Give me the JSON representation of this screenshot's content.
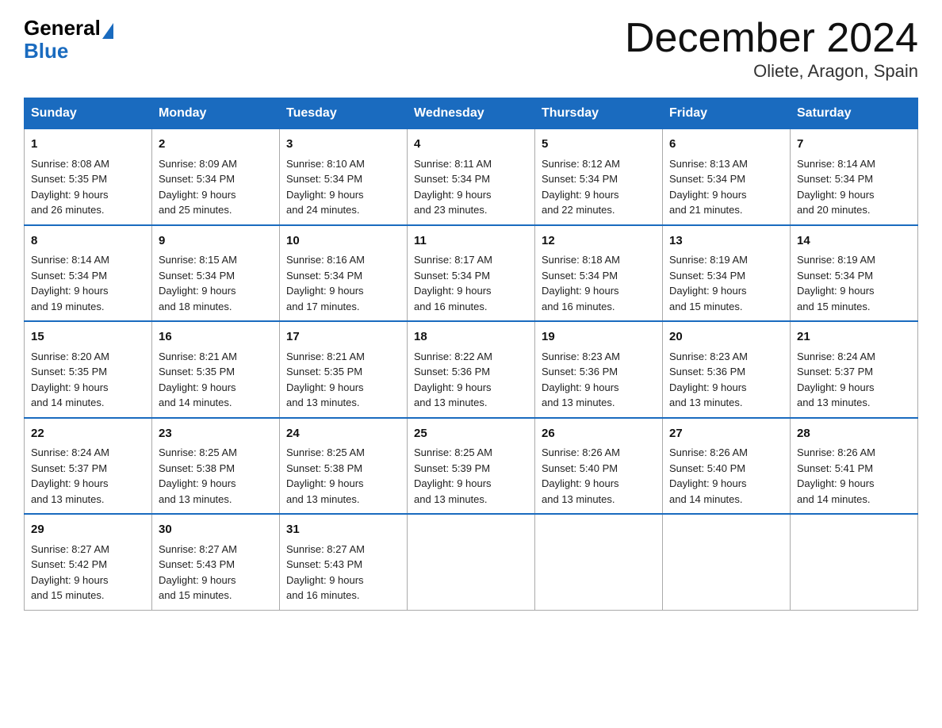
{
  "logo": {
    "general": "General",
    "blue": "Blue"
  },
  "title": "December 2024",
  "subtitle": "Oliete, Aragon, Spain",
  "days_of_week": [
    "Sunday",
    "Monday",
    "Tuesday",
    "Wednesday",
    "Thursday",
    "Friday",
    "Saturday"
  ],
  "weeks": [
    [
      {
        "day": "1",
        "sunrise": "Sunrise: 8:08 AM",
        "sunset": "Sunset: 5:35 PM",
        "daylight": "Daylight: 9 hours",
        "daylight2": "and 26 minutes."
      },
      {
        "day": "2",
        "sunrise": "Sunrise: 8:09 AM",
        "sunset": "Sunset: 5:34 PM",
        "daylight": "Daylight: 9 hours",
        "daylight2": "and 25 minutes."
      },
      {
        "day": "3",
        "sunrise": "Sunrise: 8:10 AM",
        "sunset": "Sunset: 5:34 PM",
        "daylight": "Daylight: 9 hours",
        "daylight2": "and 24 minutes."
      },
      {
        "day": "4",
        "sunrise": "Sunrise: 8:11 AM",
        "sunset": "Sunset: 5:34 PM",
        "daylight": "Daylight: 9 hours",
        "daylight2": "and 23 minutes."
      },
      {
        "day": "5",
        "sunrise": "Sunrise: 8:12 AM",
        "sunset": "Sunset: 5:34 PM",
        "daylight": "Daylight: 9 hours",
        "daylight2": "and 22 minutes."
      },
      {
        "day": "6",
        "sunrise": "Sunrise: 8:13 AM",
        "sunset": "Sunset: 5:34 PM",
        "daylight": "Daylight: 9 hours",
        "daylight2": "and 21 minutes."
      },
      {
        "day": "7",
        "sunrise": "Sunrise: 8:14 AM",
        "sunset": "Sunset: 5:34 PM",
        "daylight": "Daylight: 9 hours",
        "daylight2": "and 20 minutes."
      }
    ],
    [
      {
        "day": "8",
        "sunrise": "Sunrise: 8:14 AM",
        "sunset": "Sunset: 5:34 PM",
        "daylight": "Daylight: 9 hours",
        "daylight2": "and 19 minutes."
      },
      {
        "day": "9",
        "sunrise": "Sunrise: 8:15 AM",
        "sunset": "Sunset: 5:34 PM",
        "daylight": "Daylight: 9 hours",
        "daylight2": "and 18 minutes."
      },
      {
        "day": "10",
        "sunrise": "Sunrise: 8:16 AM",
        "sunset": "Sunset: 5:34 PM",
        "daylight": "Daylight: 9 hours",
        "daylight2": "and 17 minutes."
      },
      {
        "day": "11",
        "sunrise": "Sunrise: 8:17 AM",
        "sunset": "Sunset: 5:34 PM",
        "daylight": "Daylight: 9 hours",
        "daylight2": "and 16 minutes."
      },
      {
        "day": "12",
        "sunrise": "Sunrise: 8:18 AM",
        "sunset": "Sunset: 5:34 PM",
        "daylight": "Daylight: 9 hours",
        "daylight2": "and 16 minutes."
      },
      {
        "day": "13",
        "sunrise": "Sunrise: 8:19 AM",
        "sunset": "Sunset: 5:34 PM",
        "daylight": "Daylight: 9 hours",
        "daylight2": "and 15 minutes."
      },
      {
        "day": "14",
        "sunrise": "Sunrise: 8:19 AM",
        "sunset": "Sunset: 5:34 PM",
        "daylight": "Daylight: 9 hours",
        "daylight2": "and 15 minutes."
      }
    ],
    [
      {
        "day": "15",
        "sunrise": "Sunrise: 8:20 AM",
        "sunset": "Sunset: 5:35 PM",
        "daylight": "Daylight: 9 hours",
        "daylight2": "and 14 minutes."
      },
      {
        "day": "16",
        "sunrise": "Sunrise: 8:21 AM",
        "sunset": "Sunset: 5:35 PM",
        "daylight": "Daylight: 9 hours",
        "daylight2": "and 14 minutes."
      },
      {
        "day": "17",
        "sunrise": "Sunrise: 8:21 AM",
        "sunset": "Sunset: 5:35 PM",
        "daylight": "Daylight: 9 hours",
        "daylight2": "and 13 minutes."
      },
      {
        "day": "18",
        "sunrise": "Sunrise: 8:22 AM",
        "sunset": "Sunset: 5:36 PM",
        "daylight": "Daylight: 9 hours",
        "daylight2": "and 13 minutes."
      },
      {
        "day": "19",
        "sunrise": "Sunrise: 8:23 AM",
        "sunset": "Sunset: 5:36 PM",
        "daylight": "Daylight: 9 hours",
        "daylight2": "and 13 minutes."
      },
      {
        "day": "20",
        "sunrise": "Sunrise: 8:23 AM",
        "sunset": "Sunset: 5:36 PM",
        "daylight": "Daylight: 9 hours",
        "daylight2": "and 13 minutes."
      },
      {
        "day": "21",
        "sunrise": "Sunrise: 8:24 AM",
        "sunset": "Sunset: 5:37 PM",
        "daylight": "Daylight: 9 hours",
        "daylight2": "and 13 minutes."
      }
    ],
    [
      {
        "day": "22",
        "sunrise": "Sunrise: 8:24 AM",
        "sunset": "Sunset: 5:37 PM",
        "daylight": "Daylight: 9 hours",
        "daylight2": "and 13 minutes."
      },
      {
        "day": "23",
        "sunrise": "Sunrise: 8:25 AM",
        "sunset": "Sunset: 5:38 PM",
        "daylight": "Daylight: 9 hours",
        "daylight2": "and 13 minutes."
      },
      {
        "day": "24",
        "sunrise": "Sunrise: 8:25 AM",
        "sunset": "Sunset: 5:38 PM",
        "daylight": "Daylight: 9 hours",
        "daylight2": "and 13 minutes."
      },
      {
        "day": "25",
        "sunrise": "Sunrise: 8:25 AM",
        "sunset": "Sunset: 5:39 PM",
        "daylight": "Daylight: 9 hours",
        "daylight2": "and 13 minutes."
      },
      {
        "day": "26",
        "sunrise": "Sunrise: 8:26 AM",
        "sunset": "Sunset: 5:40 PM",
        "daylight": "Daylight: 9 hours",
        "daylight2": "and 13 minutes."
      },
      {
        "day": "27",
        "sunrise": "Sunrise: 8:26 AM",
        "sunset": "Sunset: 5:40 PM",
        "daylight": "Daylight: 9 hours",
        "daylight2": "and 14 minutes."
      },
      {
        "day": "28",
        "sunrise": "Sunrise: 8:26 AM",
        "sunset": "Sunset: 5:41 PM",
        "daylight": "Daylight: 9 hours",
        "daylight2": "and 14 minutes."
      }
    ],
    [
      {
        "day": "29",
        "sunrise": "Sunrise: 8:27 AM",
        "sunset": "Sunset: 5:42 PM",
        "daylight": "Daylight: 9 hours",
        "daylight2": "and 15 minutes."
      },
      {
        "day": "30",
        "sunrise": "Sunrise: 8:27 AM",
        "sunset": "Sunset: 5:43 PM",
        "daylight": "Daylight: 9 hours",
        "daylight2": "and 15 minutes."
      },
      {
        "day": "31",
        "sunrise": "Sunrise: 8:27 AM",
        "sunset": "Sunset: 5:43 PM",
        "daylight": "Daylight: 9 hours",
        "daylight2": "and 16 minutes."
      },
      null,
      null,
      null,
      null
    ]
  ]
}
